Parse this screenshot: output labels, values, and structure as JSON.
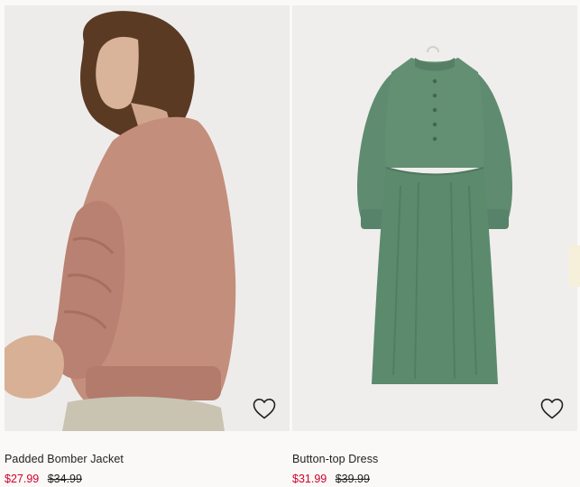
{
  "products": [
    {
      "name": "Padded Bomber Jacket",
      "sale_price": "$27.99",
      "original_price": "$34.99",
      "favorite_icon": "heart-outline-icon",
      "image": "model-wearing-pink-bomber-jacket"
    },
    {
      "name": "Button-top Dress",
      "sale_price": "$31.99",
      "original_price": "$39.99",
      "favorite_icon": "heart-outline-icon",
      "image": "green-button-top-dress"
    }
  ],
  "colors": {
    "sale": "#d0002a",
    "text": "#222222",
    "background": "#faf9f8"
  }
}
